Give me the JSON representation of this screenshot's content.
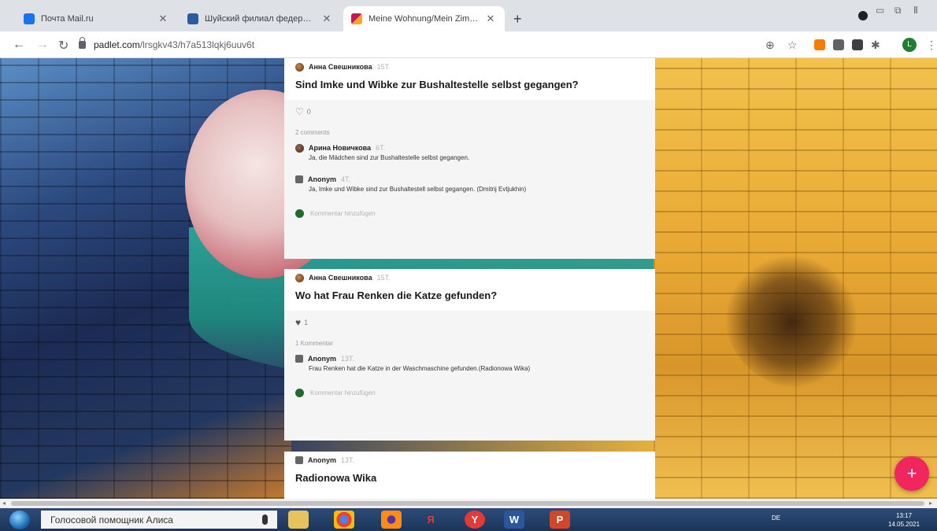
{
  "tabs": [
    {
      "title": "Почта Mail.ru",
      "color": "#1a73e8"
    },
    {
      "title": "Шуйский филиал федерального",
      "color": "#2c5aa0"
    },
    {
      "title": "Meine Wohnung/Mein Zimmer.",
      "color": "#c2185b"
    }
  ],
  "toolbar": {
    "url_host": "padlet.com",
    "url_path": "/lrsgkv43/h7a513lqkj6uuv6t",
    "profile_initial": "L"
  },
  "cards": [
    {
      "author": "Анна Свешникова",
      "time": "15T.",
      "title": "Sind Imke und Wibke zur Bushaltestelle selbst gegangen?",
      "likes": "0",
      "comment_count": "2 comments",
      "comments": [
        {
          "author": "Арина Новичкова",
          "time": "6T.",
          "text": "Ja, die Mädchen sind zur Bushaltestelle selbst gegangen."
        },
        {
          "author": "Anonym",
          "time": "4T.",
          "text": "Ja, Imke und Wibke sind zur Bushaltestell selbst gegangen. (Dmitrij Evtjukhin)"
        }
      ],
      "add_comment": "Kommentar hinzufügen"
    },
    {
      "author": "Анна Свешникова",
      "time": "15T.",
      "title": "Wo hat Frau Renken die Katze gefunden?",
      "likes": "1",
      "comment_count": "1 Kommentar",
      "comments": [
        {
          "author": "Anonym",
          "time": "13T.",
          "text": "Frau Renken hat die Katze in der Waschmaschine gefunden.(Radionowa Wika)"
        }
      ],
      "add_comment": "Kommentar hinzufügen"
    },
    {
      "author": "Anonym",
      "time": "13T.",
      "title": "Radionowa Wika"
    }
  ],
  "fab_label": "+",
  "taskbar": {
    "search_text": "Голосовой помощник Алиса",
    "lang": "DE",
    "time": "13:17",
    "date": "14.05.2021"
  }
}
